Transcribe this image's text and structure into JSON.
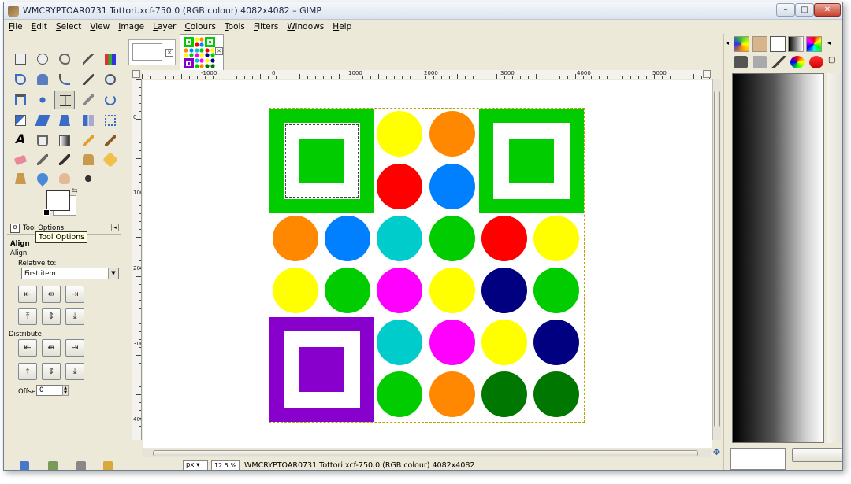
{
  "window": {
    "title": "WMCRYPTOAR0731 Tottori.xcf-750.0 (RGB colour) 4082x4082 – GIMP",
    "min_label": "–",
    "max_label": "□",
    "close_label": "✕"
  },
  "menubar": [
    {
      "u": "F",
      "rest": "ile"
    },
    {
      "u": "E",
      "rest": "dit"
    },
    {
      "u": "S",
      "rest": "elect"
    },
    {
      "u": "V",
      "rest": "iew"
    },
    {
      "u": "I",
      "rest": "mage"
    },
    {
      "u": "L",
      "rest": "ayer"
    },
    {
      "u": "C",
      "rest": "olours"
    },
    {
      "u": "T",
      "rest": "ools"
    },
    {
      "u": "F",
      "rest": "ilters"
    },
    {
      "u": "W",
      "rest": "indows"
    },
    {
      "u": "H",
      "rest": "elp"
    }
  ],
  "tool_options": {
    "tab_label": "Tool Options",
    "tooltip": "Tool Options",
    "title": "Align",
    "subtitle": "Align",
    "relative_to_label": "Relative to:",
    "relative_to_value": "First item",
    "distribute_label": "Distribute",
    "offset_label": "Offset:",
    "offset_value": "0"
  },
  "ruler": {
    "h_labels": [
      "-1000",
      "0",
      "1000",
      "2000",
      "3000",
      "4000",
      "5000"
    ],
    "v_labels": [
      "0",
      "1000",
      "2000",
      "3000",
      "4000"
    ]
  },
  "statusbar": {
    "unit": "px",
    "zoom": "12.5 %",
    "text": "WMCRYPTOAR0731 Tottori.xcf-750.0 (RGB colour) 4082x4082"
  },
  "colors": {
    "green": "#00cc00",
    "yellow": "#ffff00",
    "orange": "#ff8800",
    "red": "#ff0000",
    "blue": "#0080ff",
    "cyan": "#00cccc",
    "magenta": "#ff00ff",
    "navy": "#000080",
    "dark_green": "#007700",
    "purple": "#8800cc"
  }
}
